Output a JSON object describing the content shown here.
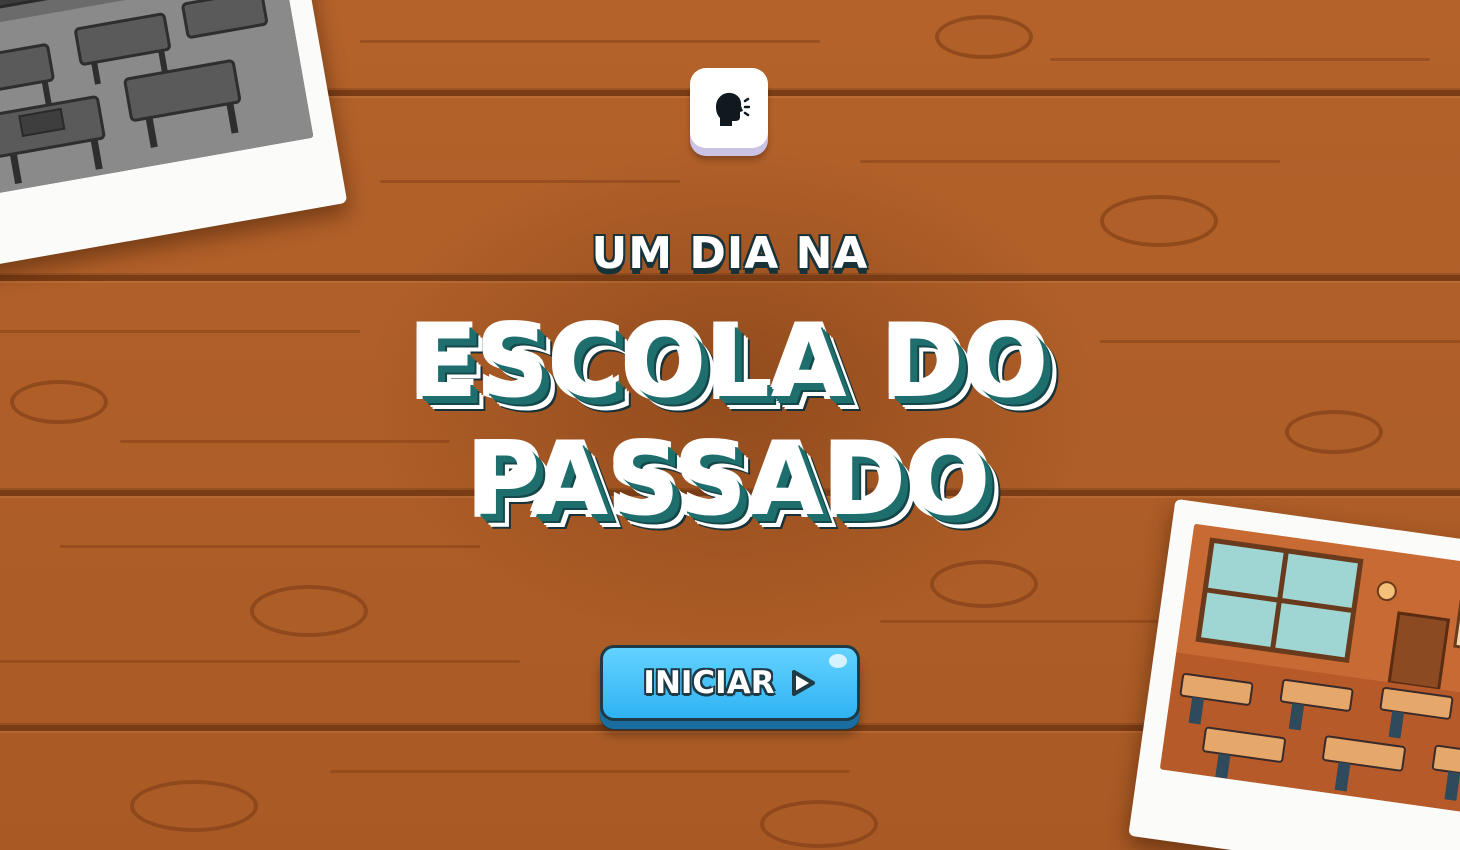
{
  "title": {
    "line_small": "UM DIA NA",
    "line_big_1": "ESCOLA DO",
    "line_big_2": "PASSADO"
  },
  "buttons": {
    "start_label": "INICIAR",
    "narration_icon": "speaking-head-icon",
    "start_icon": "play-icon"
  },
  "images": {
    "top_left": "black-and-white old classroom photo",
    "bottom_right": "colored modern classroom photo"
  },
  "colors": {
    "wood": "#a85a22",
    "title_fill": "#ffffff",
    "title_shadow": "#1f6e6e",
    "button": "#3cc0f7",
    "outline": "#1d3a46"
  }
}
